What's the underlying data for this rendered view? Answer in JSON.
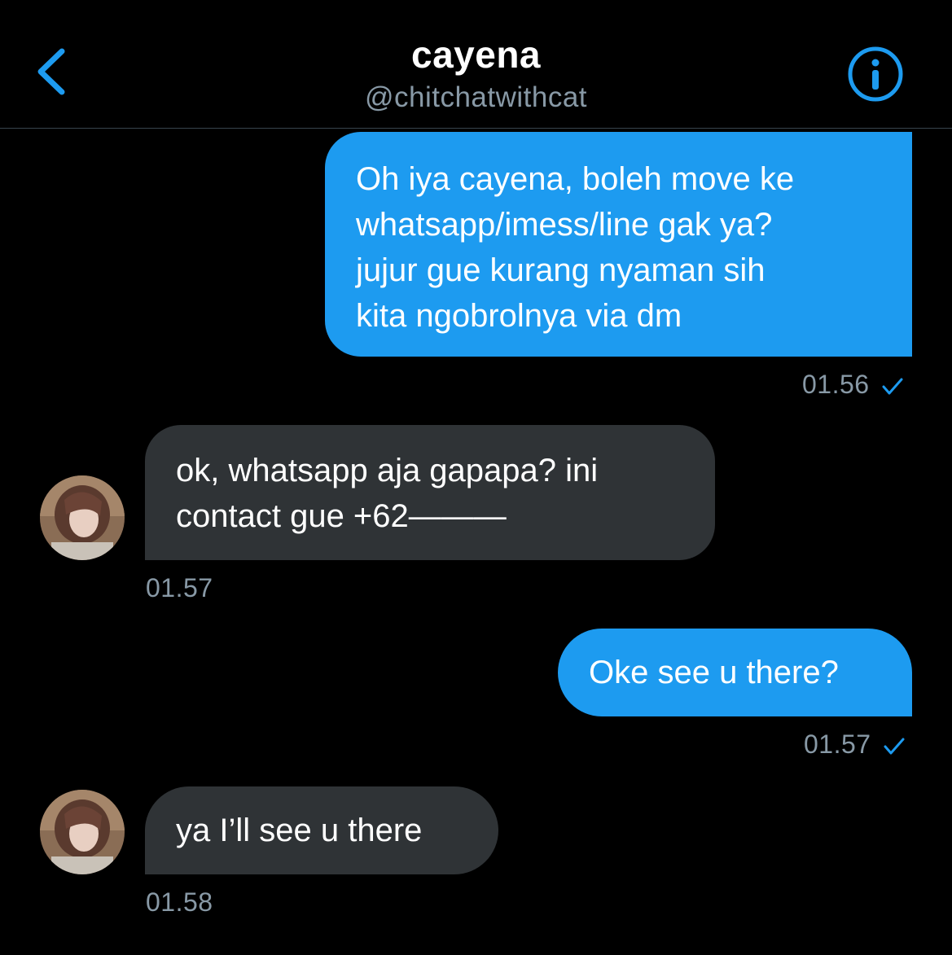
{
  "header": {
    "title": "cayena",
    "handle": "@chitchatwithcat",
    "back_icon": "chevron-left-icon",
    "info_icon": "info-circle-icon",
    "accent": "#1d9bf0"
  },
  "messages": [
    {
      "direction": "outgoing",
      "lines": [
        "Oh iya cayena, boleh move ke",
        "whatsapp/imess/line gak ya?",
        "jujur gue kurang nyaman sih",
        "kita ngobrolnya via dm"
      ],
      "time": "01.56",
      "status_icon": "check-icon"
    },
    {
      "direction": "incoming",
      "lines": [
        "ok, whatsapp aja gapapa? ini",
        "contact gue +62———"
      ],
      "time": "01.57"
    },
    {
      "direction": "outgoing",
      "lines": [
        "Oke see u there?"
      ],
      "time": "01.57",
      "status_icon": "check-icon"
    },
    {
      "direction": "incoming",
      "lines": [
        "ya I’ll see u there"
      ],
      "time": "01.58"
    }
  ],
  "colors": {
    "outgoing_bubble": "#1d9bf0",
    "incoming_bubble": "#2f3336",
    "timestamp": "#8899a6",
    "background": "#000000"
  }
}
